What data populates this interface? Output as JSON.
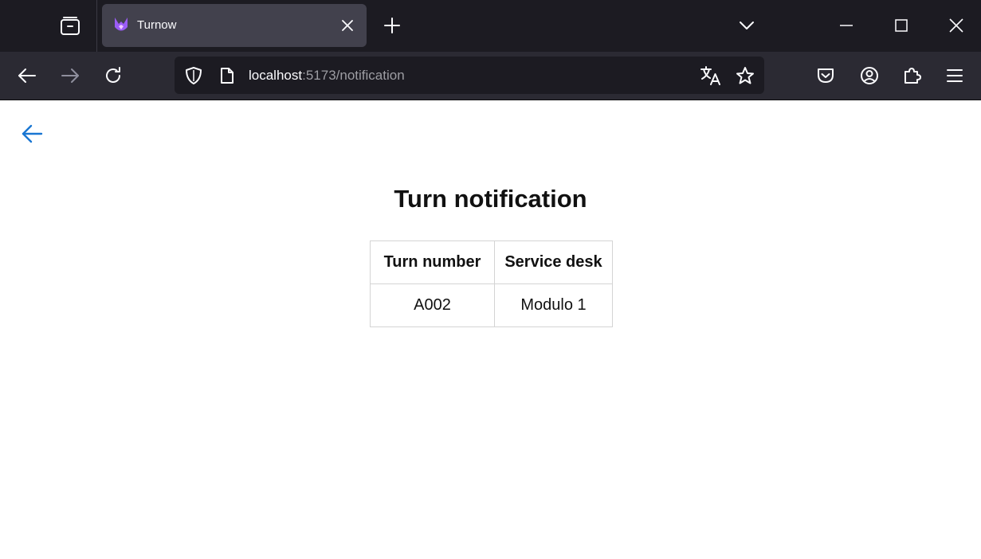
{
  "browser": {
    "tab": {
      "title": "Turnow",
      "favicon": "turnow-logo-icon"
    },
    "url": {
      "host": "localhost",
      "rest": ":5173/notification"
    },
    "colors": {
      "tabbar_bg": "#1c1b22",
      "navbar_bg": "#2b2a33",
      "active_tab_bg": "#42414d",
      "icon": "#fbfbfe"
    }
  },
  "page": {
    "title": "Turn notification",
    "back_icon": "arrow-left-icon",
    "accent_color": "#1976d2",
    "table": {
      "headers": [
        "Turn number",
        "Service desk"
      ],
      "rows": [
        [
          "A002",
          "Modulo 1"
        ]
      ]
    }
  }
}
